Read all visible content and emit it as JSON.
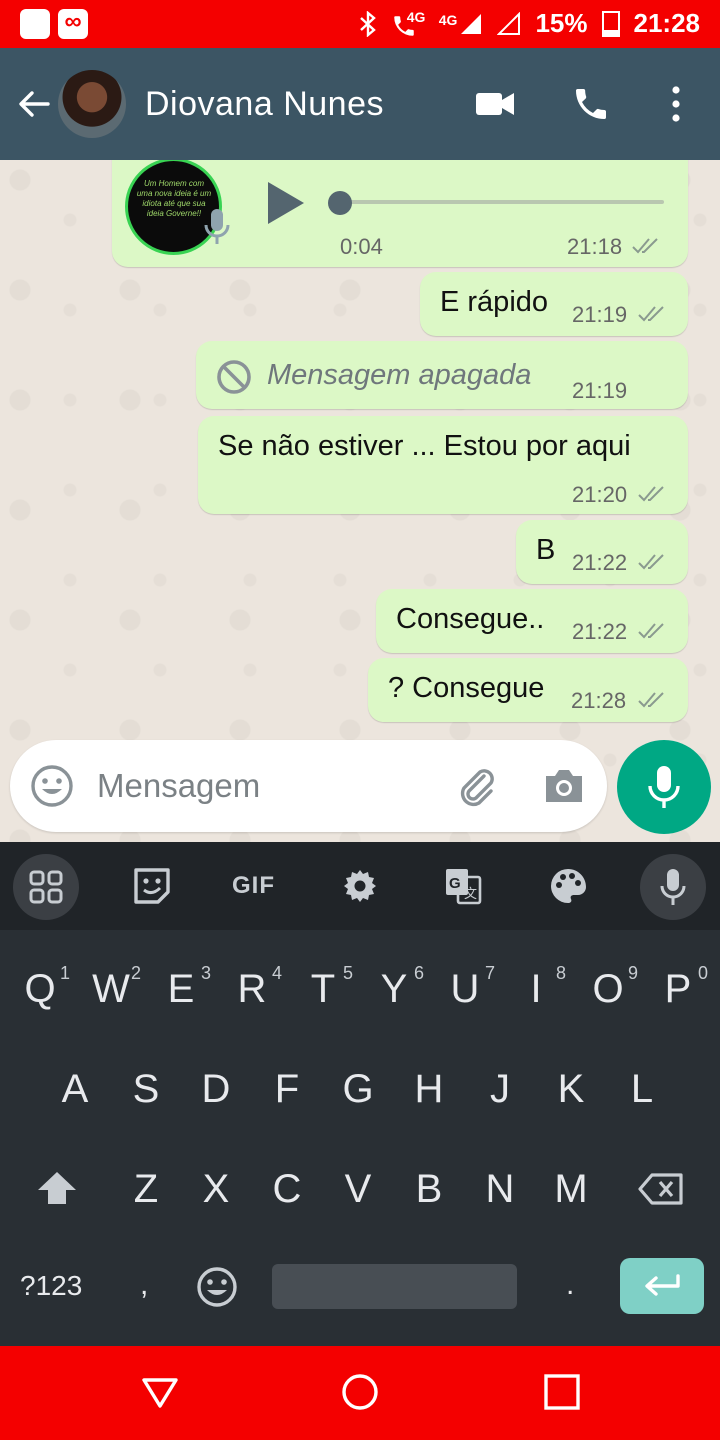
{
  "status_bar": {
    "network_call_label": "4G",
    "network_label": "4G",
    "battery": "15%",
    "time": "21:28",
    "icons": [
      "notification-square-icon",
      "voicemail-icon",
      "bluetooth-icon",
      "volte-call-icon",
      "signal-icon",
      "battery-icon"
    ]
  },
  "header": {
    "contact_name": "Diovana Nunes",
    "icons": [
      "back-arrow-icon",
      "video-call-icon",
      "phone-icon",
      "more-vert-icon"
    ]
  },
  "messages": [
    {
      "type": "audio",
      "duration": "0:04",
      "time": "21:18",
      "status": "read",
      "thumb_text": "Um Homem com uma nova ideia é um idiota até que sua ideia Governe!!"
    },
    {
      "type": "text",
      "text": "E rápido",
      "time": "21:19",
      "status": "read"
    },
    {
      "type": "deleted",
      "text": "Mensagem apagada",
      "time": "21:19"
    },
    {
      "type": "text",
      "text": "Se não estiver ... Estou por aqui",
      "time": "21:20",
      "status": "read"
    },
    {
      "type": "text",
      "text": "B",
      "time": "21:22",
      "status": "read"
    },
    {
      "type": "text",
      "text": "Consegue..",
      "time": "21:22",
      "status": "read"
    },
    {
      "type": "text",
      "text": "? Consegue",
      "time": "21:28",
      "status": "read"
    }
  ],
  "composer": {
    "placeholder": "Mensagem",
    "icons": [
      "emoji-icon",
      "attach-icon",
      "camera-icon",
      "mic-icon"
    ]
  },
  "keyboard": {
    "toolbar": {
      "gif_label": "GIF"
    },
    "row1": [
      {
        "key": "Q",
        "hint": "1"
      },
      {
        "key": "W",
        "hint": "2"
      },
      {
        "key": "E",
        "hint": "3"
      },
      {
        "key": "R",
        "hint": "4"
      },
      {
        "key": "T",
        "hint": "5"
      },
      {
        "key": "Y",
        "hint": "6"
      },
      {
        "key": "U",
        "hint": "7"
      },
      {
        "key": "I",
        "hint": "8"
      },
      {
        "key": "O",
        "hint": "9"
      },
      {
        "key": "P",
        "hint": "0"
      }
    ],
    "row2": [
      "A",
      "S",
      "D",
      "F",
      "G",
      "H",
      "J",
      "K",
      "L"
    ],
    "row3": [
      "Z",
      "X",
      "C",
      "V",
      "B",
      "N",
      "M"
    ],
    "symbols_label": "?123",
    "comma_label": ",",
    "period_label": "."
  },
  "colors": {
    "status_bar": "#f40000",
    "header": "#3c5564",
    "bubble_out": "#dcf8c6",
    "accent": "#00a884",
    "keyboard_bg": "#292f34"
  }
}
